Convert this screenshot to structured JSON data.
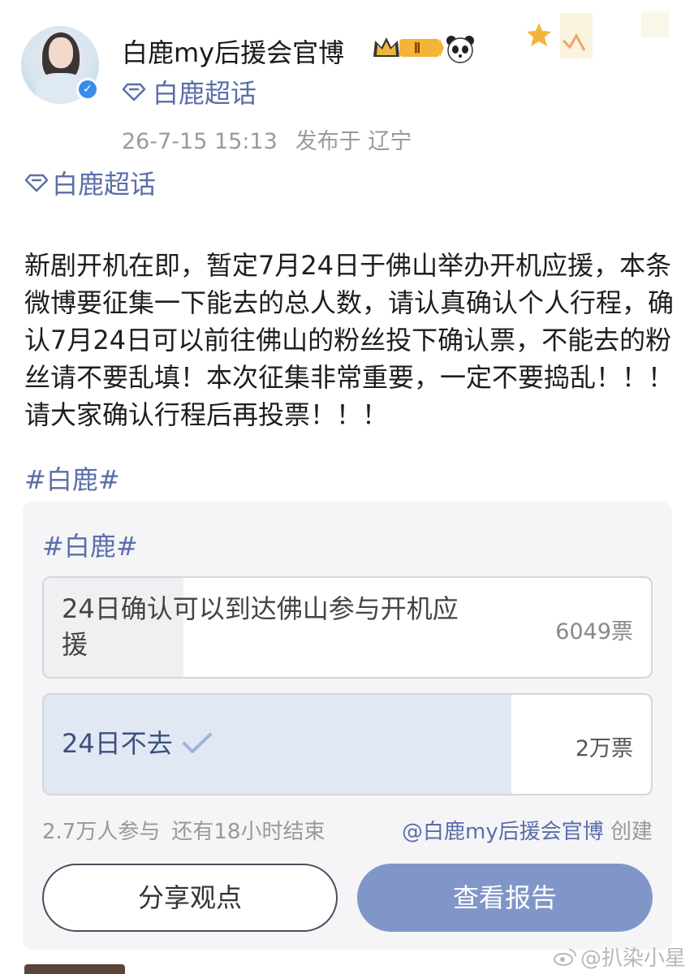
{
  "post": {
    "username": "白鹿my后援会官博",
    "badge_level": "Ⅱ",
    "topic": "白鹿超话",
    "timestamp": "26-7-15 15:13",
    "location": "发布于 辽宁",
    "topic_tag": "白鹿超话",
    "body": "新剧开机在即，暂定7月24日于佛山举办开机应援，本条微博要征集一下能去的总人数，请认真确认个人行程，确认7月24日可以前往佛山的粉丝投下确认票，不能去的粉丝请不要乱填！本次征集非常重要，一定不要捣乱！！！请大家确认行程后再投票！！！",
    "hashtag": "#白鹿#"
  },
  "poll": {
    "tag": "#白鹿#",
    "options": [
      {
        "label": "24日确认可以到达佛山参与开机应援",
        "votes": "6049票",
        "fraction": 0.23,
        "selected": false
      },
      {
        "label": "24日不去",
        "votes": "2万票",
        "fraction": 0.77,
        "selected": true
      }
    ],
    "participants": "2.7万人参与",
    "remaining": "还有18小时结束",
    "creator": "@白鹿my后援会官博",
    "creator_suffix": "创建",
    "share_label": "分享观点",
    "report_label": "查看报告"
  },
  "watermark": "@扒染小星",
  "colors": {
    "link": "#5b6ea8",
    "accent_button": "#8196c8",
    "selected_fill": "#e1e8f4",
    "verified": "#3b8bea"
  },
  "icons": {
    "verified": "verified-check-icon",
    "topic": "diamond-icon",
    "check": "checkmark-icon",
    "panda": "panda-emoji-icon",
    "weibo": "weibo-logo-icon"
  }
}
